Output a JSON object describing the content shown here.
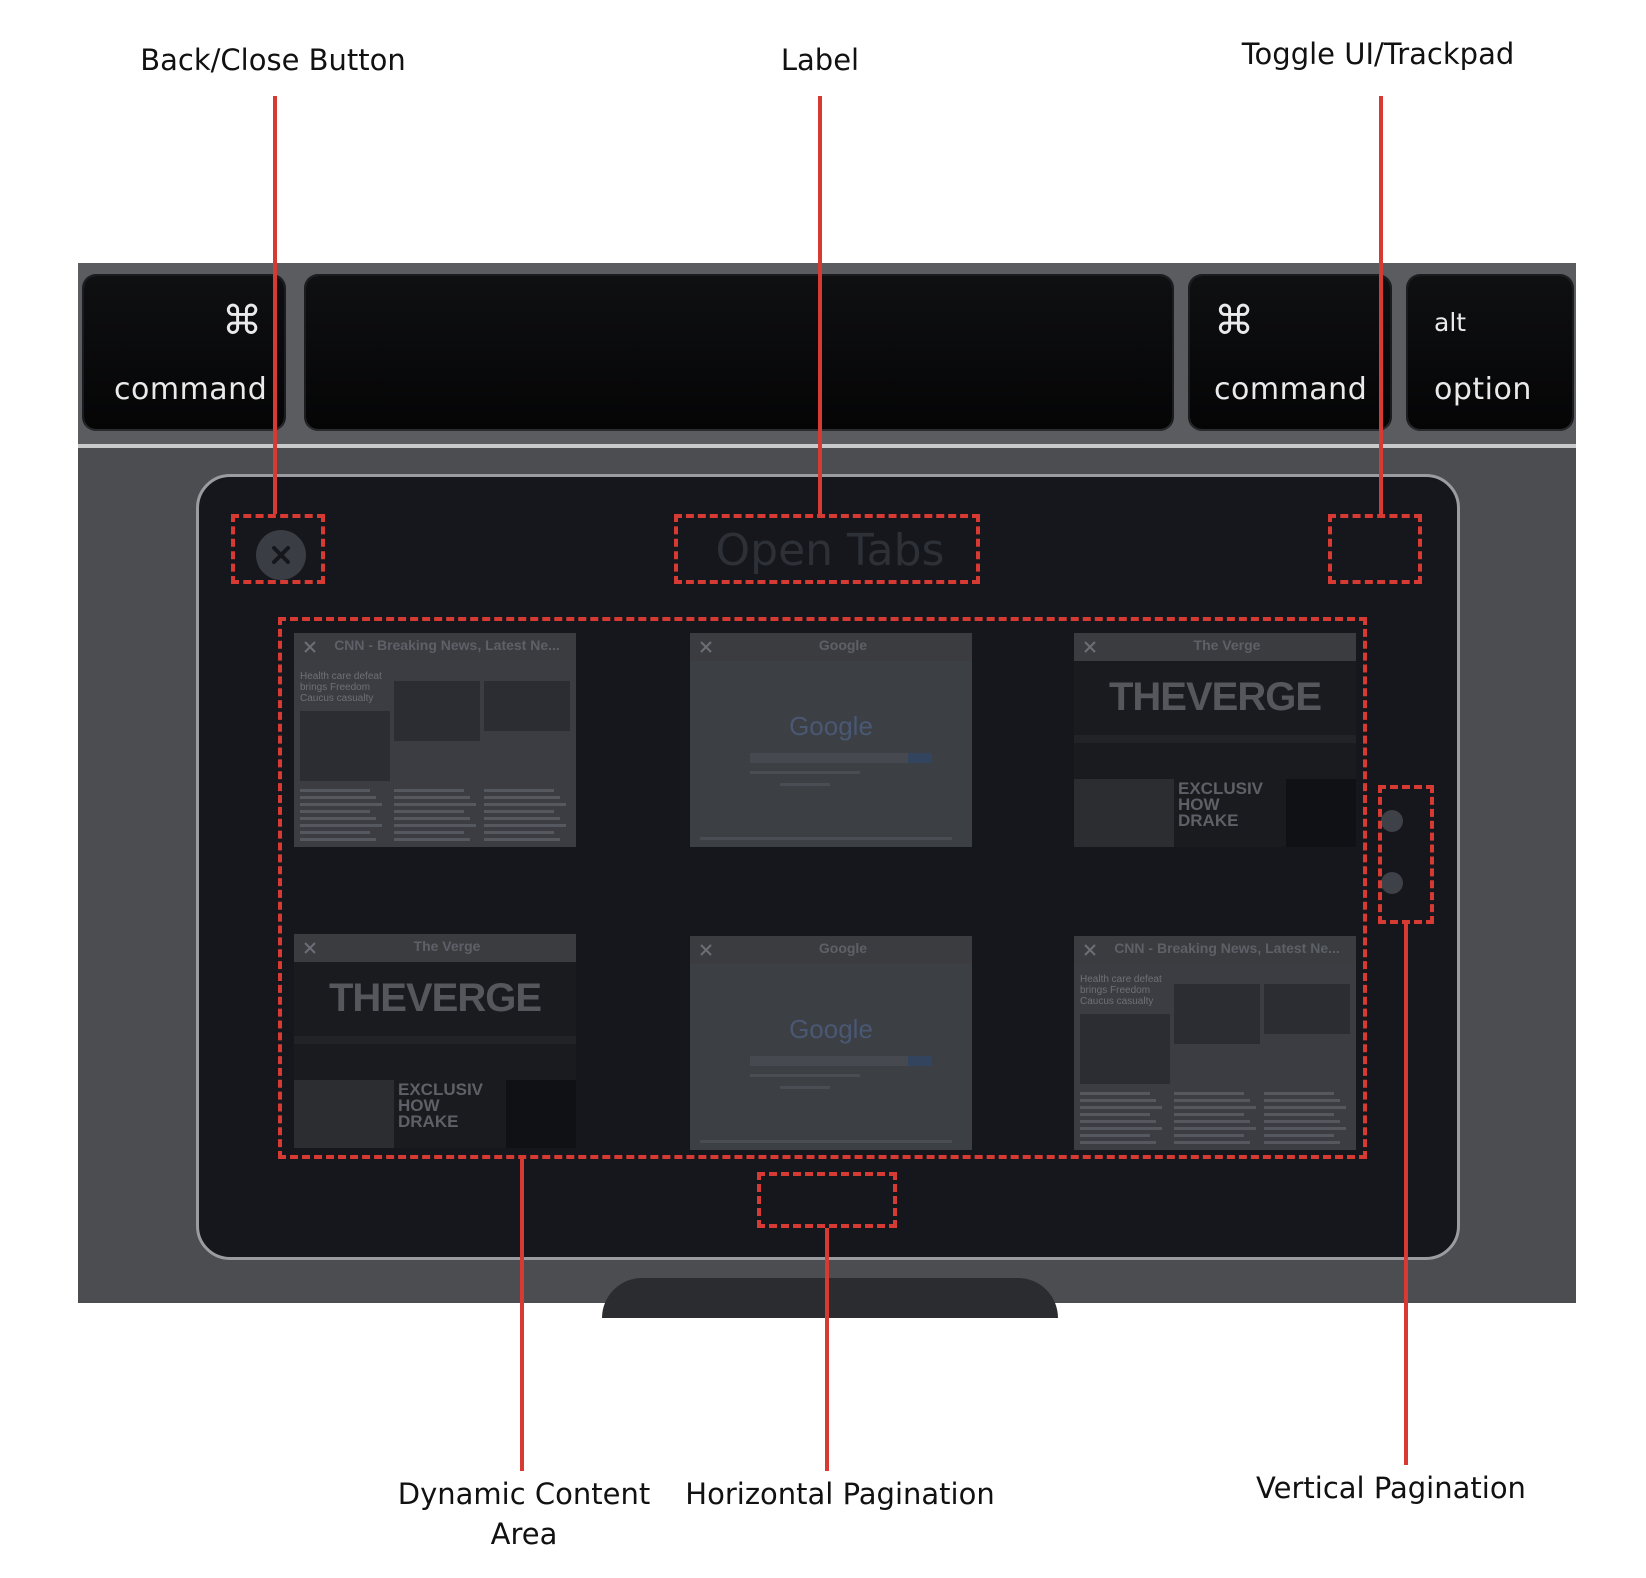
{
  "callouts": {
    "back_close": "Back/Close Button",
    "label": "Label",
    "toggle": "Toggle UI/Trackpad",
    "dynamic_line1": "Dynamic Content",
    "dynamic_line2": "Area",
    "horizontal": "Horizontal Pagination",
    "vertical": "Vertical Pagination"
  },
  "keys": {
    "left_command_glyph": "⌘",
    "left_command": "command",
    "right_command_glyph": "⌘",
    "right_command": "command",
    "alt": "alt",
    "option": "option"
  },
  "touchbar": {
    "title": "Open Tabs"
  },
  "tabs": [
    {
      "title": "CNN - Breaking News, Latest Ne...",
      "kind": "cnn"
    },
    {
      "title": "Google",
      "kind": "google"
    },
    {
      "title": "The Verge",
      "kind": "verge"
    },
    {
      "title": "The Verge",
      "kind": "verge"
    },
    {
      "title": "Google",
      "kind": "google"
    },
    {
      "title": "CNN - Breaking News, Latest Ne...",
      "kind": "cnn"
    }
  ],
  "thumb_text": {
    "google_logo": "Google",
    "verge_logo": "THEVERGE",
    "verge_headline": "EXCLUSIV\nHOW\nDRAKE",
    "cnn_headline": "Health care defeat brings Freedom Caucus casualty"
  },
  "pagination": {
    "vertical_dots": 2
  },
  "colors": {
    "callout_red": "#d63a32",
    "pad_bg": "#15171c",
    "keyboard_bg": "#5a5c60"
  }
}
